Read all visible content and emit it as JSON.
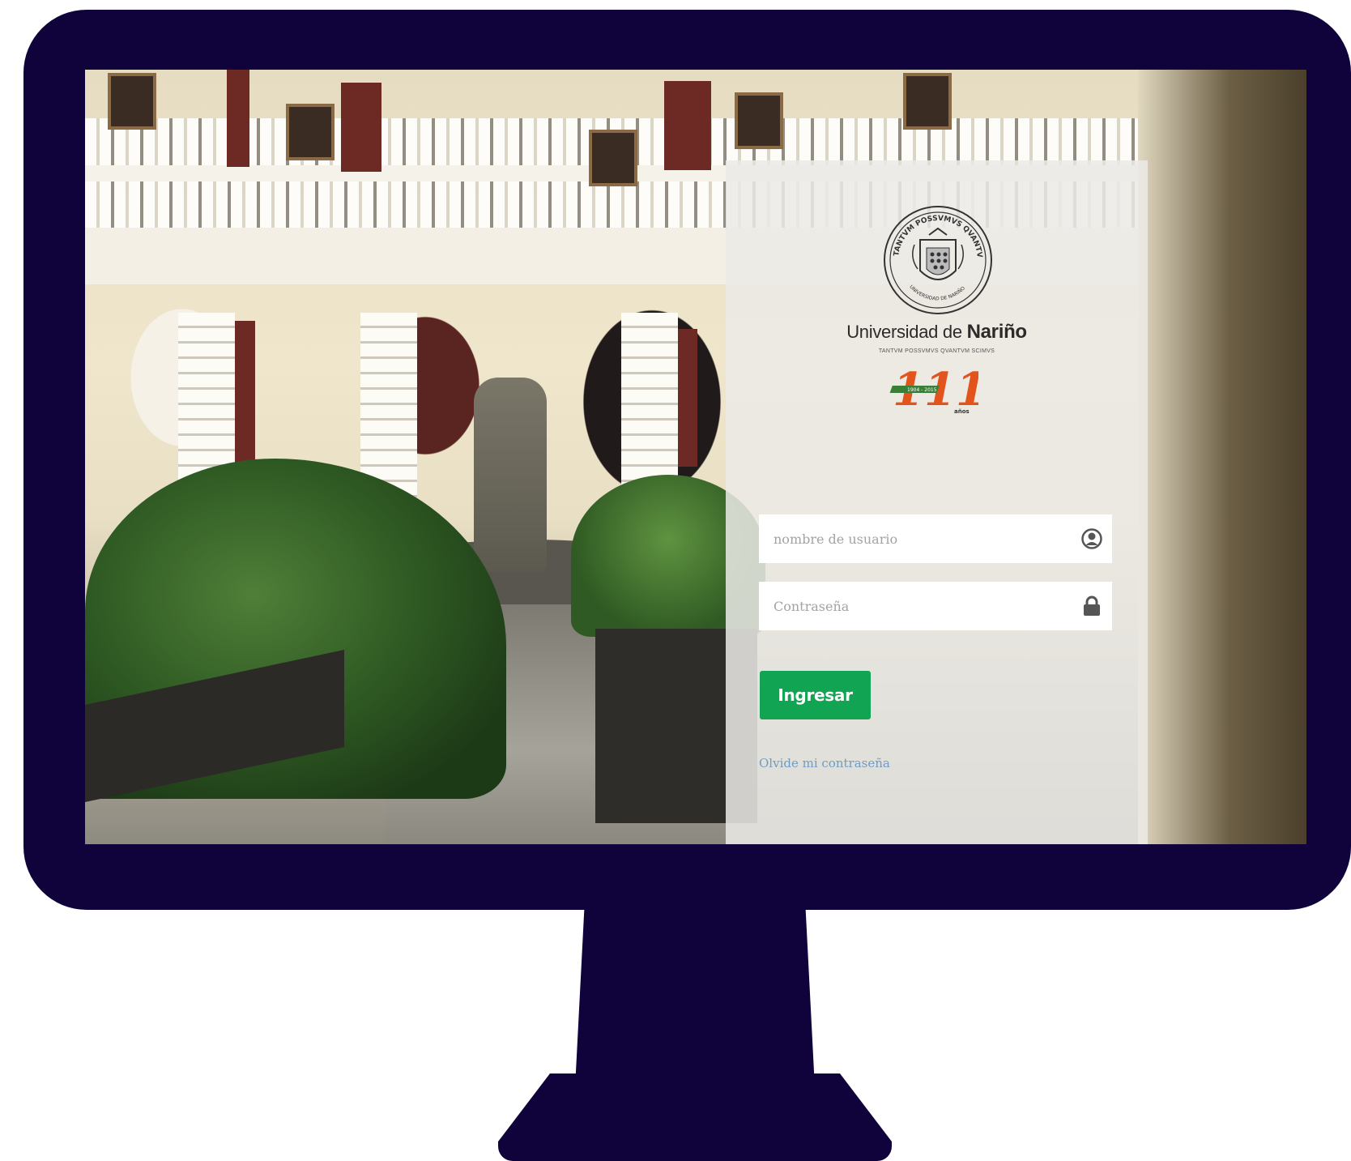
{
  "university": {
    "name_prefix": "Universidad de ",
    "name_bold": "Nariño",
    "motto": "TANTVM POSSVMVS QVANTVM SCIMVS",
    "seal_top_text": "TANTVM POSSVMVS QVANTVM SCIMVS",
    "seal_bottom_text": "UNIVERSIDAD DE NARIÑO",
    "anniversary_number": "111",
    "anniversary_years": "1904 - 2015",
    "anniversary_word": "años"
  },
  "login": {
    "username_placeholder": "nombre de usuario",
    "username_value": "",
    "password_placeholder": "Contraseña",
    "password_value": "",
    "submit_label": "Ingresar",
    "forgot_label": "Olvide mi contraseña"
  },
  "icons": {
    "username": "user-circle-icon",
    "password": "lock-icon"
  },
  "colors": {
    "monitor": "#10033b",
    "button": "#11a553",
    "link": "#6f9cc4",
    "panel": "#ebeae7"
  }
}
